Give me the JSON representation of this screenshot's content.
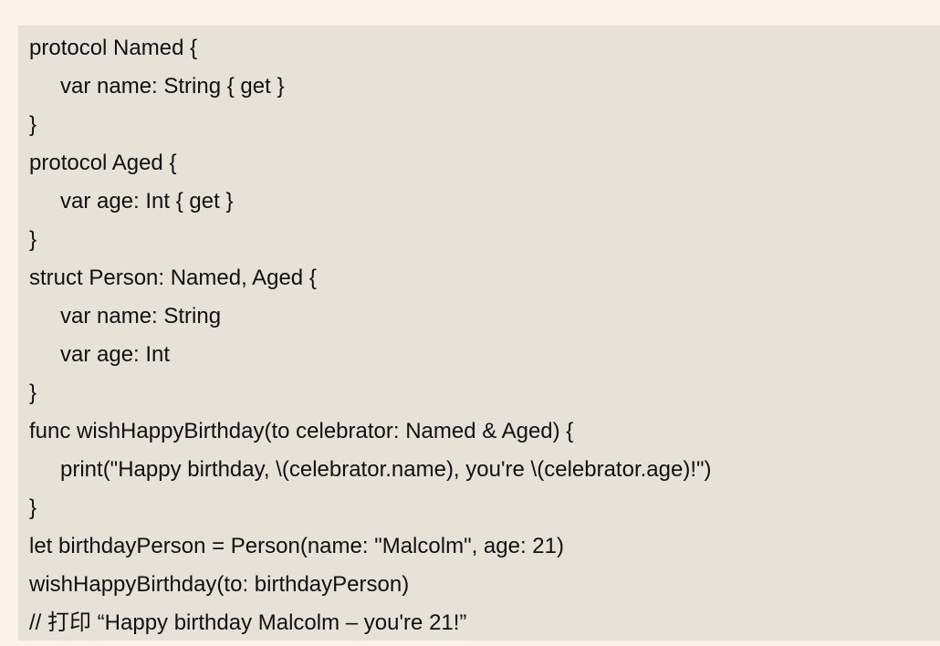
{
  "code": {
    "lines": [
      {
        "text": "protocol Named {",
        "indent": 0
      },
      {
        "text": "var name: String { get }",
        "indent": 1
      },
      {
        "text": "}",
        "indent": 0
      },
      {
        "text": "protocol Aged {",
        "indent": 0
      },
      {
        "text": "var age: Int { get }",
        "indent": 1
      },
      {
        "text": "}",
        "indent": 0
      },
      {
        "text": "struct Person: Named, Aged {",
        "indent": 0
      },
      {
        "text": "var name: String",
        "indent": 1
      },
      {
        "text": "var age: Int",
        "indent": 1
      },
      {
        "text": "}",
        "indent": 0
      },
      {
        "text": "func wishHappyBirthday(to celebrator: Named & Aged) {",
        "indent": 0
      },
      {
        "text": "print(\"Happy birthday, \\(celebrator.name), you're \\(celebrator.age)!\")",
        "indent": 1
      },
      {
        "text": "}",
        "indent": 0
      },
      {
        "text": "let birthdayPerson = Person(name: \"Malcolm\", age: 21)",
        "indent": 0
      },
      {
        "text": "wishHappyBirthday(to: birthdayPerson)",
        "indent": 0
      },
      {
        "text": "// 打印 “Happy birthday Malcolm – you're 21!”",
        "indent": 0
      }
    ]
  },
  "colors": {
    "page_background": "#f9f3ea",
    "code_background": "#e7e2d8",
    "text": "#111111"
  }
}
